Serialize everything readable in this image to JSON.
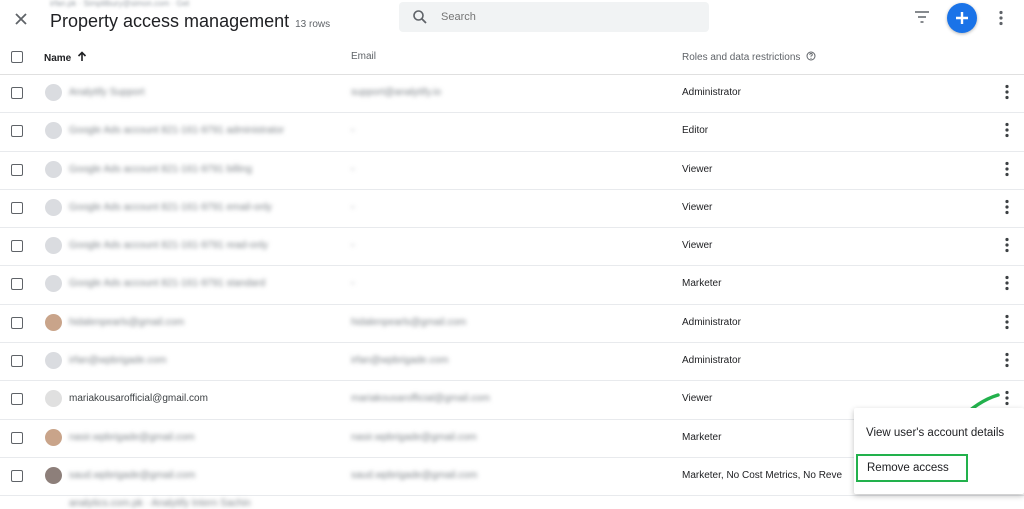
{
  "header": {
    "subtitle": "irfan.pk · Simplilbury@simon.com · Get",
    "title": "Property access management",
    "row_count": "13 rows",
    "search_placeholder": "Search"
  },
  "columns": {
    "name": "Name",
    "email": "Email",
    "roles": "Roles and data restrictions"
  },
  "rows": [
    {
      "name": "Analytify Support",
      "email": "support@analytify.io",
      "role": "Administrator",
      "avatar": "blank"
    },
    {
      "name": "Google Ads account 821-161-9791 administrator",
      "email": "-",
      "role": "Editor",
      "avatar": "blank"
    },
    {
      "name": "Google Ads account 821-161-9791 billing",
      "email": "-",
      "role": "Viewer",
      "avatar": "blank"
    },
    {
      "name": "Google Ads account 821-161-9791 email-only",
      "email": "-",
      "role": "Viewer",
      "avatar": "blank"
    },
    {
      "name": "Google Ads account 821-161-9791 read-only",
      "email": "-",
      "role": "Viewer",
      "avatar": "blank"
    },
    {
      "name": "Google Ads account 821-161-9791 standard",
      "email": "-",
      "role": "Marketer",
      "avatar": "blank"
    },
    {
      "name": "hidalenpearls@gmail.com",
      "email": "hidalenpearls@gmail.com",
      "role": "Administrator",
      "avatar": "photo"
    },
    {
      "name": "irfan@wpbrigade.com",
      "email": "irfan@wpbrigade.com",
      "role": "Administrator",
      "avatar": "blank"
    },
    {
      "name": "mariakousarofficial@gmail.com",
      "email": "mariakousarofficial@gmail.com",
      "role": "Viewer",
      "avatar": "clear"
    },
    {
      "name": "nasir.wpbrigade@gmail.com",
      "email": "nasir.wpbrigade@gmail.com",
      "role": "Marketer",
      "avatar": "photo"
    },
    {
      "name": "saud.wpbrigade@gmail.com",
      "email": "saud.wpbrigade@gmail.com",
      "role": "Marketer, No Cost Metrics, No Reve",
      "avatar": "dark"
    }
  ],
  "partial_row_text": "analytics.com.pk · Analytify Intern Sachin",
  "context_menu": {
    "view_details": "View user's account details",
    "remove_access": "Remove access"
  },
  "colors": {
    "accent": "#1a73e8",
    "highlight": "#22b14c"
  },
  "icons": [
    "close-icon",
    "search-icon",
    "filter-icon",
    "add-icon",
    "more-vert-icon",
    "help-icon",
    "arrow-up-icon"
  ]
}
